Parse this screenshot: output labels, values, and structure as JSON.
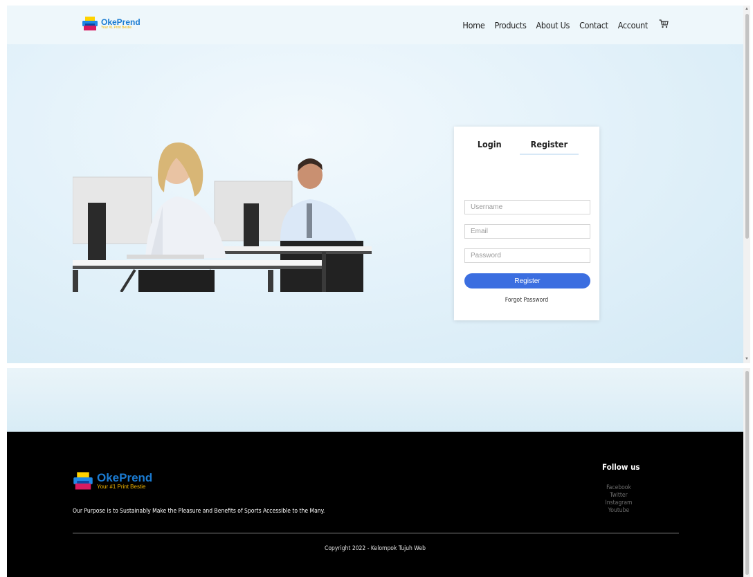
{
  "brand": {
    "name": "OkePrend",
    "tagline": "Your #1 Print Bestie"
  },
  "nav": {
    "items": [
      "Home",
      "Products",
      "About Us",
      "Contact",
      "Account"
    ],
    "cart_icon": "cart-icon"
  },
  "auth": {
    "tab_login": "Login",
    "tab_register": "Register",
    "active_tab": "Register",
    "username_placeholder": "Username",
    "email_placeholder": "Email",
    "password_placeholder": "Password",
    "submit_label": "Register",
    "forgot_label": "Forgot Password"
  },
  "footer": {
    "purpose": "Our Purpose is to Sustainably Make the Pleasure and Benefits of Sports Accessible to the Many.",
    "follow_title": "Follow us",
    "socials": [
      "Facebook",
      "Twitter",
      "Instagram",
      "Youtube"
    ],
    "copyright": "Copyright 2022 - Kelompok Tujuh Web"
  },
  "colors": {
    "accent": "#3b6ee0",
    "brand_blue": "#1b7bd1",
    "brand_yellow": "#f2b600",
    "footer_bg": "#000000",
    "hero_bg": "#dcedf7"
  }
}
